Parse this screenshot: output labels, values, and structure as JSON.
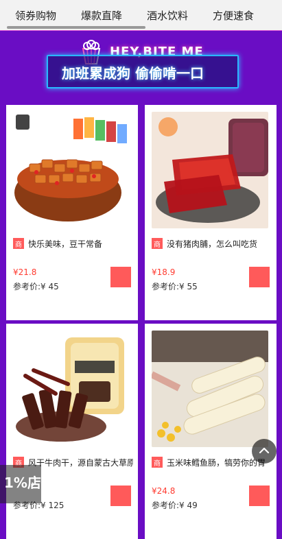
{
  "tabs": {
    "items": [
      "领券购物",
      "爆款直降",
      "酒水饮料",
      "方便速食"
    ]
  },
  "banner": {
    "title": "HEY,BITE ME",
    "subtitle": "加班累成狗 偷偷啃一口"
  },
  "products": [
    {
      "badge": "商",
      "name": "快乐美味，豆干常备",
      "price": "¥21.8",
      "reference": "参考价:¥ 45"
    },
    {
      "badge": "商",
      "name": "没有猪肉脯，怎么叫吃货",
      "price": "¥18.9",
      "reference": "参考价:¥ 55"
    },
    {
      "badge": "商",
      "name": "风干牛肉干，源自蒙古大草原",
      "price": "",
      "reference": "参考价:¥ 125"
    },
    {
      "badge": "商",
      "name": "玉米味鳕鱼肠，犒劳你的胃",
      "price": "¥24.8",
      "reference": "参考价:¥ 49"
    }
  ],
  "floating": {
    "left_label": "1%店"
  },
  "colors": {
    "background": "#6a0dc4",
    "accent": "#ff5a5a",
    "price": "#ff3b30"
  }
}
